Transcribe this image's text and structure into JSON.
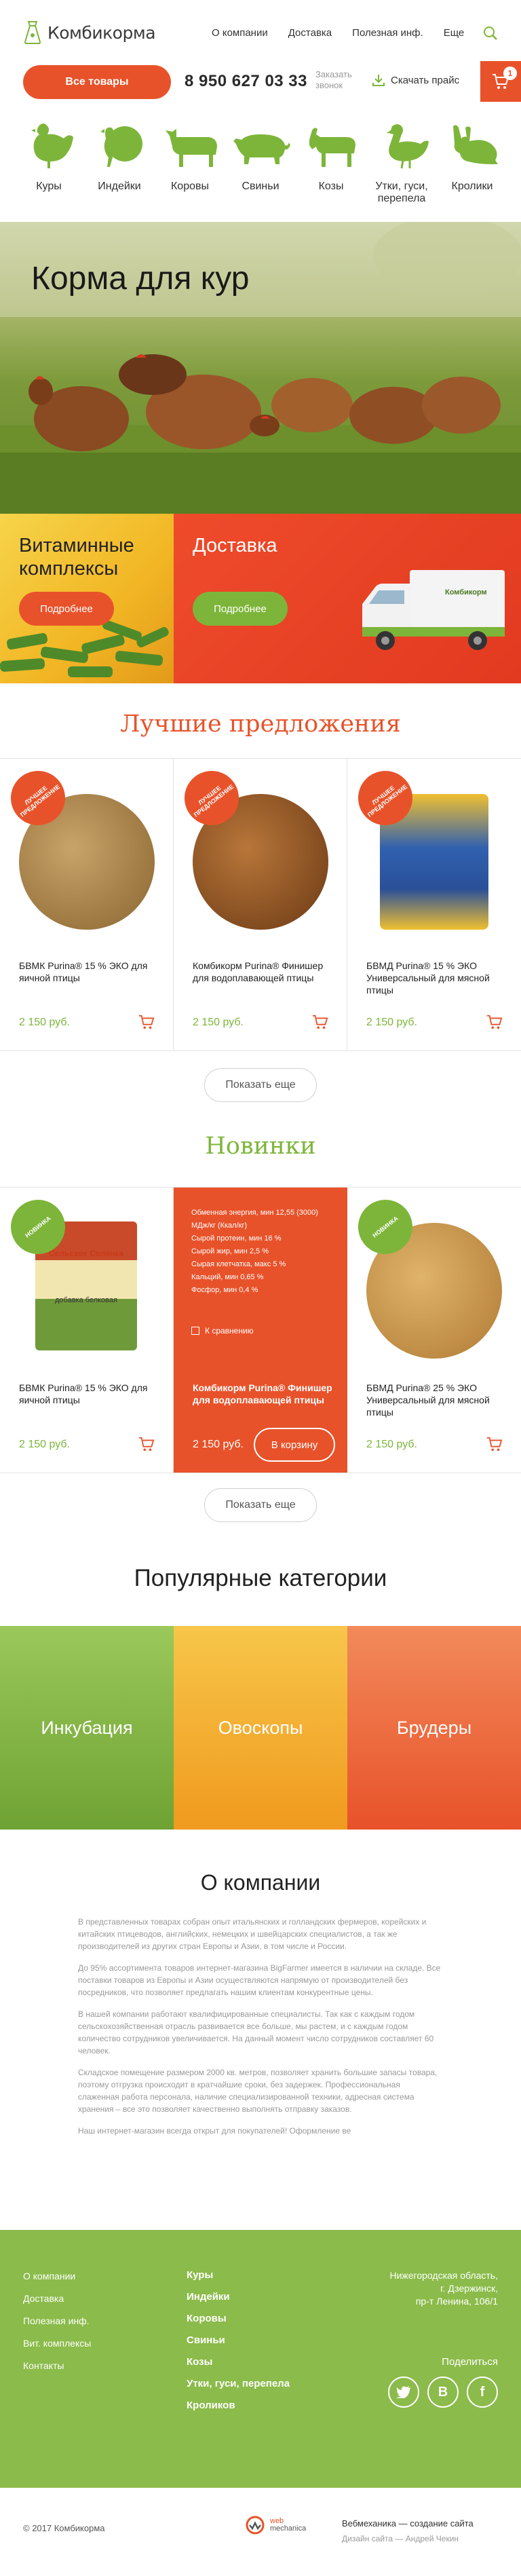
{
  "header": {
    "logo_text": "Комбикорма",
    "menu": [
      "О компании",
      "Доставка",
      "Полезная инф.",
      "Еще"
    ],
    "all_goods_label": "Все товары",
    "phone": "8 950 627 03 33",
    "callback_label": "Заказать звонок",
    "price_download_label": "Скачать прайс",
    "cart_count": "1"
  },
  "categories": [
    {
      "label": "Куры",
      "icon": "chicken-icon"
    },
    {
      "label": "Индейки",
      "icon": "turkey-icon"
    },
    {
      "label": "Коровы",
      "icon": "cow-icon"
    },
    {
      "label": "Свиньи",
      "icon": "pig-icon"
    },
    {
      "label": "Козы",
      "icon": "goat-icon"
    },
    {
      "label": "Утки, гуси, перепела",
      "icon": "goose-icon"
    },
    {
      "label": "Кролики",
      "icon": "rabbit-icon"
    }
  ],
  "hero": {
    "title": "Корма для кур"
  },
  "promo": {
    "vitamins_title": "Витаминные комплексы",
    "vitamins_btn": "Подробнее",
    "delivery_title": "Доставка",
    "delivery_btn": "Подробнее",
    "truck_brand": "Комбикорм"
  },
  "best": {
    "title": "Лучшие предложения",
    "tag": "Лучшее предложение",
    "products": [
      {
        "name": "БВМК Purina® 15 % ЭКО для яичной птицы",
        "price": "2 150 руб."
      },
      {
        "name": "Комбикорм Purina® Финишер для водоплавающей птицы",
        "price": "2 150 руб."
      },
      {
        "name": "БВМД Purina® 15 % ЭКО Универсальный для мясной птицы",
        "price": "2 150 руб."
      }
    ],
    "more": "Показать еще"
  },
  "news": {
    "title": "Новинки",
    "tag": "Новинка",
    "products": [
      {
        "name": "БВМК Purina® 15 % ЭКО для яичной птицы",
        "price": "2 150 руб.",
        "pack_brand": "Сельское Селянка",
        "pack_subtitle": "добавка белковая"
      },
      {
        "name": "Комбикорм Purina® Финишер для водоплавающей птицы",
        "price": "2 150 руб."
      },
      {
        "name": "БВМД Purina® 25 % ЭКО Универсальный для мясной птицы",
        "price": "2 150 руб."
      }
    ],
    "specs": [
      "Обменная энергия, мин 12,55 (3000) МДж/кг (Ккал/кг)",
      "Сырой протеин, мин 16 %",
      "Сырой жир, мин 2,5 %",
      "Сырая клетчатка, макс 5 %",
      "Кальций, мин 0,65 %",
      "Фосфор, мин 0,4 %"
    ],
    "compare": "К сравнению",
    "to_cart": "В корзину",
    "more": "Показать еще"
  },
  "popular": {
    "title": "Популярные категории",
    "tiles": [
      "Инкубация",
      "Овоскопы",
      "Брудеры"
    ]
  },
  "about": {
    "title": "О компании",
    "paragraphs": [
      "В представленных товарах собран опыт итальянских и голландских фермеров, корейских и китайских птицеводов, английских, немецких и швейцарских специалистов, а так же производителей из других стран Европы и Азии, в том числе и России.",
      "До 95% ассортимента товаров интернет-магазина BigFarmer имеется в наличии на складе. Все поставки товаров из Европы и Азии осуществляются напрямую от производителей без посредников, что позволяет предлагать нашим клиентам конкурентные цены.",
      "В нашей компании работают квалифицированные специалисты. Так как с каждым годом сельскохозяйственная отрасль развивается все больше, мы растем, и с каждым годом количество сотрудников увеличивается. На данный момент число сотрудников составляет 60 человек.",
      "Складское помещение размером 2000 кв. метров, позволяет хранить большие запасы товара, поэтому отгрузка происходит в кратчайшие сроки, без задержек. Профессиональная слаженная работа персонала, наличие специализированной техники, адресная система хранения – все это позволяет качественно выполнять отправку заказов.",
      "Наш интернет-магазин всегда открыт для покупателей! Оформление ве"
    ]
  },
  "footer": {
    "links": [
      "О компании",
      "Доставка",
      "Полезная инф.",
      "Вит. комплексы",
      "Контакты"
    ],
    "categories": [
      "Куры",
      "Индейки",
      "Коровы",
      "Свиньи",
      "Козы",
      "Утки, гуси, перепела",
      "Кроликов"
    ],
    "address": [
      "Нижегородская область,",
      "г. Дзержинск,",
      "пр-т Ленина, 106/1"
    ],
    "share": "Поделиться",
    "copyright": "© 2017 Комбикорма",
    "webmechanica_1": "web",
    "webmechanica_2": "mechanica",
    "dev_line1": "Вебмеханика — создание сайта",
    "dev_line2": "Дизайн сайта — Андрей Чекин"
  },
  "colors": {
    "accent": "#e8522a",
    "green": "#7db53a",
    "footer": "#8bbb4a"
  }
}
